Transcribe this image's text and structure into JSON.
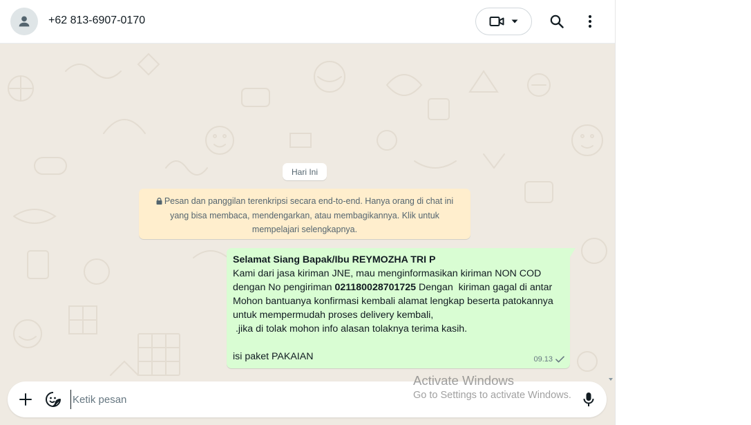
{
  "header": {
    "contact_name": "+62 813-6907-0170",
    "icons": [
      "person-avatar-icon",
      "video-call-icon",
      "chevron-down-icon",
      "search-icon",
      "kebab-menu-icon"
    ]
  },
  "chat": {
    "date_label": "Hari Ini",
    "encryption_notice": {
      "line1": "Pesan dan panggilan terenkripsi secara end-to-end. Hanya orang di chat ini",
      "line2": "yang bisa membaca, mendengarkan, atau membagikannya. Klik untuk",
      "line3": "mempelajari selengkapnya."
    },
    "message": {
      "greeting": "Selamat Siang Bapak/Ibu REYMOZHA TRI P",
      "line2": "Kami dari jasa kiriman JNE, mau menginformasikan kiriman NON COD",
      "line3_pre": "dengan No pengiriman ",
      "tracking_number": "021180028701725",
      "line3_post": " Dengan  kiriman gagal di antar",
      "line4": "Mohon bantuanya konfirmasi kembali alamat lengkap beserta patokannya",
      "line5": "untuk mempermudah proses delivery kembali,",
      "line6": " .jika di tolak mohon info alasan tolaknya terima kasih.",
      "line8": "isi paket PAKAIAN",
      "time": "09.13",
      "status": "sent"
    }
  },
  "composer": {
    "placeholder": "Ketik pesan",
    "value": ""
  },
  "watermark": {
    "title": "Activate Windows",
    "subtitle": "Go to Settings to activate Windows."
  },
  "colors": {
    "chat_background": "#efeae2",
    "outgoing_bubble": "#d9fdd3",
    "system_note": "#ffeecd",
    "icon_gray": "#54656f"
  }
}
